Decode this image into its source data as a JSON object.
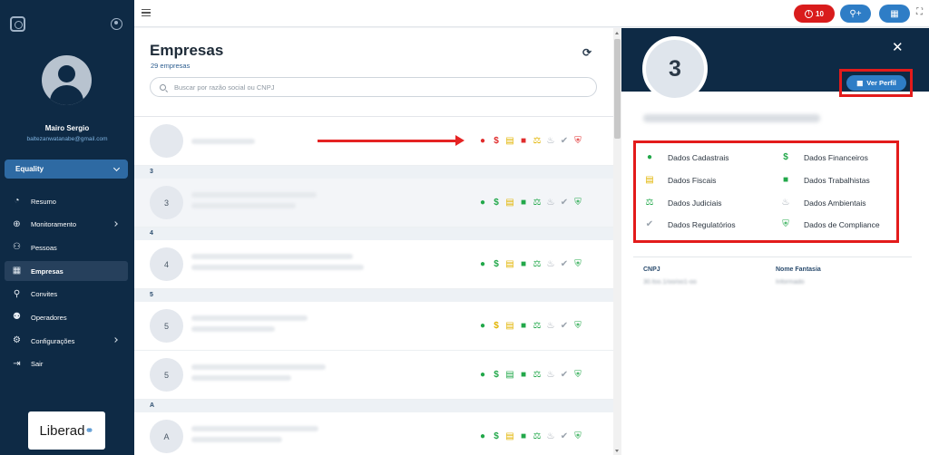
{
  "colors": {
    "cadastrais_green": "#22a84a",
    "fiscal_yellow": "#e2b400",
    "alert_red": "#d91c1c",
    "sidebar_bg": "#0e2a45",
    "primary_blue": "#2e7dc6"
  },
  "sidebar": {
    "user_name": "Mairo Sergio",
    "user_email": "baltezanwatanabe@gmail.com",
    "org_selected": "Equality",
    "items": [
      {
        "label": "Resumo",
        "icon": "pie-chart-icon"
      },
      {
        "label": "Monitoramento",
        "icon": "globe-icon"
      },
      {
        "label": "Pessoas",
        "icon": "people-icon"
      },
      {
        "label": "Empresas",
        "icon": "store-icon"
      },
      {
        "label": "Convites",
        "icon": "add-user-icon"
      },
      {
        "label": "Operadores",
        "icon": "operators-icon"
      },
      {
        "label": "Configurações",
        "icon": "gear-icon"
      },
      {
        "label": "Sair",
        "icon": "logout-icon"
      }
    ],
    "brand": "Liberad"
  },
  "topbar": {
    "alert_count": "10"
  },
  "companies": {
    "title": "Empresas",
    "count": "29 empresas",
    "search_placeholder": "Buscar por razão social ou CNPJ",
    "groups": [
      "3",
      "4",
      "5",
      "A"
    ],
    "rows": [
      {
        "avatar": ""
      },
      {
        "avatar": "3"
      },
      {
        "avatar": "4"
      },
      {
        "avatar": "5"
      },
      {
        "avatar": "5"
      },
      {
        "avatar": "A"
      }
    ]
  },
  "detail": {
    "avatar_letter": "3",
    "ver_perfil": "Ver Perfil",
    "categories": [
      {
        "label": "Dados Cadastrais",
        "icon": "user-circle-icon"
      },
      {
        "label": "Dados Financeiros",
        "icon": "dollar-icon"
      },
      {
        "label": "Dados Fiscais",
        "icon": "receipt-icon"
      },
      {
        "label": "Dados Trabalhistas",
        "icon": "briefcase-icon"
      },
      {
        "label": "Dados Judiciais",
        "icon": "scales-icon"
      },
      {
        "label": "Dados Ambientais",
        "icon": "environment-icon"
      },
      {
        "label": "Dados Regulatórios",
        "icon": "check-badge-icon"
      },
      {
        "label": "Dados de Compliance",
        "icon": "shield-icon"
      }
    ],
    "cnpj_label": "CNPJ",
    "cnpj_value": "30.foo.1/oo/oo1-oo",
    "nome_fantasia_label": "Nome Fantasia",
    "nome_fantasia_value": "Informado"
  }
}
